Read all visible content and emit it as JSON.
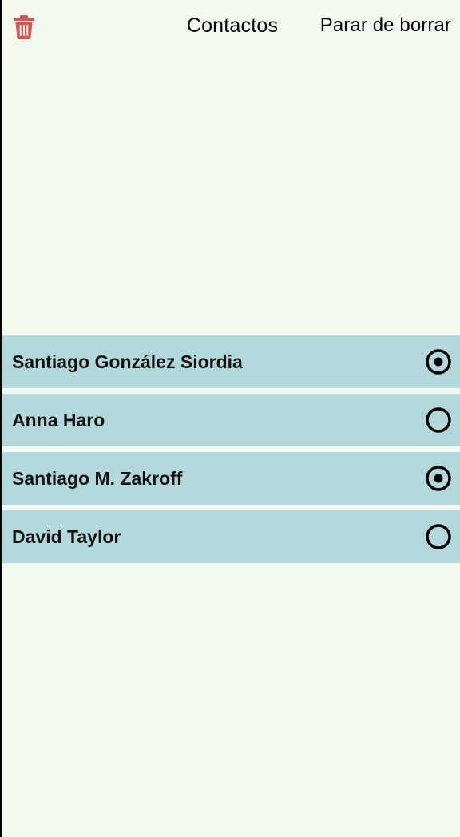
{
  "nav": {
    "title": "Contactos",
    "stop_label": "Parar de borrar",
    "trash_icon": "trash-icon"
  },
  "colors": {
    "background": "#f2f9ef",
    "row": "#b1d9dc",
    "trash": "#d9534f",
    "text": "#000000"
  },
  "contacts": [
    {
      "name": "Santiago González Siordia",
      "selected": true
    },
    {
      "name": "Anna Haro",
      "selected": false
    },
    {
      "name": "Santiago M. Zakroff",
      "selected": true
    },
    {
      "name": "David Taylor",
      "selected": false
    }
  ]
}
